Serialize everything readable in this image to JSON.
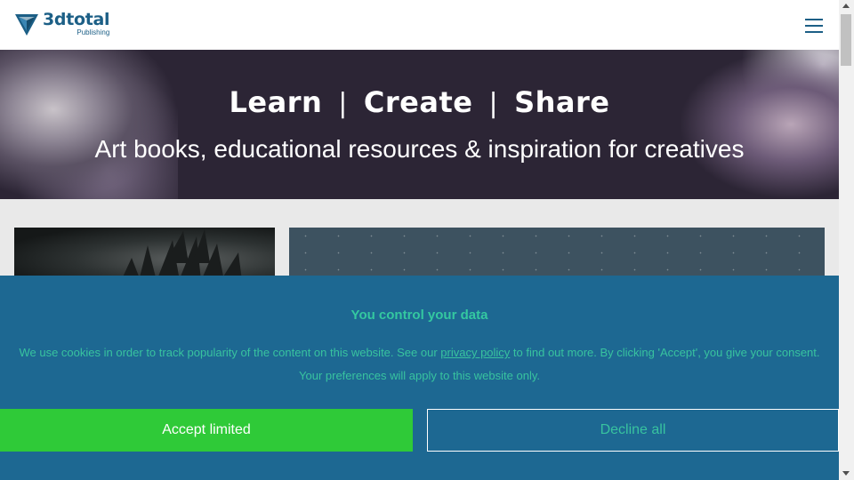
{
  "header": {
    "logo_name": "3dtotal",
    "logo_sub": "Publishing",
    "menu_icon": "hamburger-menu-icon"
  },
  "hero": {
    "title_parts": [
      "Learn",
      "Create",
      "Share"
    ],
    "separator": "|",
    "subtitle": "Art books, educational resources & inspiration for creatives"
  },
  "cookie": {
    "title": "You control your data",
    "text_before": "We use cookies in order to track popularity of the content on this website. See our ",
    "link_text": "privacy policy",
    "text_after": " to find out more. By clicking 'Accept', you give your consent.",
    "text_line2": "Your preferences will apply to this website only.",
    "accept_label": "Accept limited",
    "decline_label": "Decline all"
  },
  "colors": {
    "brand": "#1c5f86",
    "banner_bg": "#1d6892",
    "accent_green": "#2fca38",
    "teal_text": "#38c39f"
  }
}
